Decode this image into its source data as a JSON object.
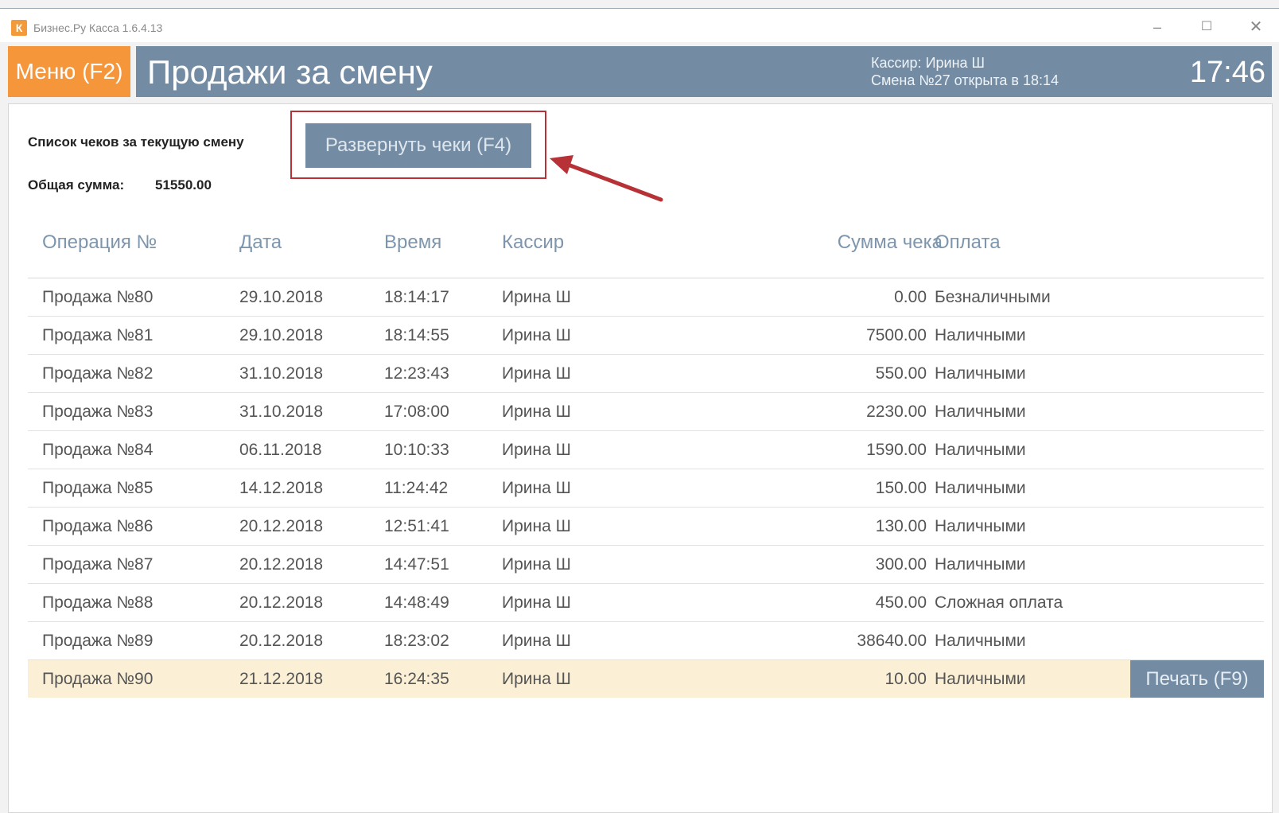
{
  "window": {
    "title": "Бизнес.Ру Касса 1.6.4.13",
    "icon_letter": "К",
    "controls": {
      "minimize": "–",
      "maximize": "☐",
      "close": "✕"
    }
  },
  "header": {
    "menu_label": "Меню (F2)",
    "title": "Продажи за смену",
    "cashier": "Кассир: Ирина Ш",
    "shift": "Смена №27 открыта в 18:14",
    "clock": "17:46"
  },
  "summary": {
    "list_label": "Список чеков за текущую смену",
    "total_label": "Общая сумма:",
    "total_value": "51550.00",
    "expand_button": "Развернуть чеки (F4)"
  },
  "table": {
    "columns": [
      "Операция №",
      "Дата",
      "Время",
      "Кассир",
      "Сумма чека",
      "Оплата"
    ],
    "rows": [
      [
        "Продажа №80",
        "29.10.2018",
        "18:14:17",
        "Ирина Ш",
        "0.00",
        "Безналичными"
      ],
      [
        "Продажа №81",
        "29.10.2018",
        "18:14:55",
        "Ирина Ш",
        "7500.00",
        "Наличными"
      ],
      [
        "Продажа №82",
        "31.10.2018",
        "12:23:43",
        "Ирина Ш",
        "550.00",
        "Наличными"
      ],
      [
        "Продажа №83",
        "31.10.2018",
        "17:08:00",
        "Ирина Ш",
        "2230.00",
        "Наличными"
      ],
      [
        "Продажа №84",
        "06.11.2018",
        "10:10:33",
        "Ирина Ш",
        "1590.00",
        "Наличными"
      ],
      [
        "Продажа №85",
        "14.12.2018",
        "11:24:42",
        "Ирина Ш",
        "150.00",
        "Наличными"
      ],
      [
        "Продажа №86",
        "20.12.2018",
        "12:51:41",
        "Ирина Ш",
        "130.00",
        "Наличными"
      ],
      [
        "Продажа №87",
        "20.12.2018",
        "14:47:51",
        "Ирина Ш",
        "300.00",
        "Наличными"
      ],
      [
        "Продажа №88",
        "20.12.2018",
        "14:48:49",
        "Ирина Ш",
        "450.00",
        "Сложная оплата"
      ],
      [
        "Продажа №89",
        "20.12.2018",
        "18:23:02",
        "Ирина Ш",
        "38640.00",
        "Наличными"
      ],
      [
        "Продажа №90",
        "21.12.2018",
        "16:24:35",
        "Ирина Ш",
        "10.00",
        "Наличными"
      ]
    ],
    "selected_row": 10,
    "print_button": "Печать (F9)"
  },
  "colors": {
    "accent_orange": "#f5963a",
    "header_blue": "#738ca4",
    "highlight_red": "#b73236",
    "selected_row": "#fbf0d6"
  }
}
